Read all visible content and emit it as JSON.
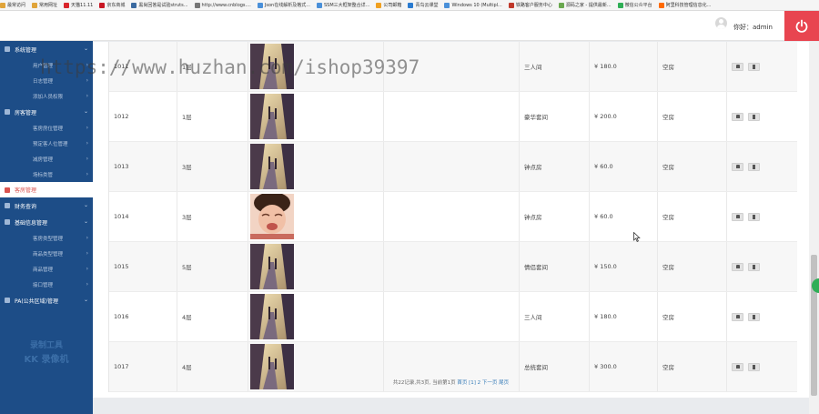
{
  "bookmarks": [
    {
      "label": "最常访问",
      "color": "#e0a43a"
    },
    {
      "label": "常用网址",
      "color": "#e0a43a"
    },
    {
      "label": "天猫11.11",
      "color": "#d9252b"
    },
    {
      "label": "京东商城",
      "color": "#c81623"
    },
    {
      "label": "黑尚回答是试验struts...",
      "color": "#3b6aa0"
    },
    {
      "label": "http://www.cnblogs....",
      "color": "#777777"
    },
    {
      "label": "Json在线解析及格式...",
      "color": "#4a90d9"
    },
    {
      "label": "SSM三大框架整合详...",
      "color": "#4a90d9"
    },
    {
      "label": "公司邮箱",
      "color": "#f0a020"
    },
    {
      "label": "青鸟云课堂",
      "color": "#2a7bd0"
    },
    {
      "label": "Windows 10 (Multipl...",
      "color": "#4a90d9"
    },
    {
      "label": "铁路客户服务中心",
      "color": "#c0392b"
    },
    {
      "label": "源码之家 - 提供最新...",
      "color": "#6aa84f"
    },
    {
      "label": "微信公众平台",
      "color": "#2fae56"
    },
    {
      "label": "阿里科技管理信息化...",
      "color": "#ff6a00"
    }
  ],
  "header": {
    "greeting": "你好：admin",
    "accent": "#e84550"
  },
  "sidebar": {
    "items": [
      {
        "kind": "section",
        "label": "系统管理"
      },
      {
        "kind": "sub",
        "label": "用户管理"
      },
      {
        "kind": "sub",
        "label": "日志管理"
      },
      {
        "kind": "sub",
        "label": "添加人员权限"
      },
      {
        "kind": "section",
        "label": "房客管理"
      },
      {
        "kind": "sub",
        "label": "客房房位管理"
      },
      {
        "kind": "sub",
        "label": "预定客人位管理"
      },
      {
        "kind": "sub",
        "label": "减房管理"
      },
      {
        "kind": "sub",
        "label": "场标类管"
      },
      {
        "kind": "active",
        "label": "客房管理"
      },
      {
        "kind": "section",
        "label": "财务查询"
      },
      {
        "kind": "section",
        "label": "基础信息管理"
      },
      {
        "kind": "sub",
        "label": "客房类型管理"
      },
      {
        "kind": "sub",
        "label": "商品类型管理"
      },
      {
        "kind": "sub",
        "label": "商品管理"
      },
      {
        "kind": "sub",
        "label": "接口管理"
      },
      {
        "kind": "section",
        "label": "PA(公共区域)管理"
      }
    ],
    "watermark_line1": "录制工具",
    "watermark_line2": "KK 录像机"
  },
  "table": {
    "rows": [
      {
        "id": "1011",
        "floor": "1层",
        "img": "street",
        "type": "三人间",
        "price": "¥ 180.0",
        "status": "空房"
      },
      {
        "id": "1012",
        "floor": "1层",
        "img": "street",
        "type": "豪华套间",
        "price": "¥ 200.0",
        "status": "空房"
      },
      {
        "id": "1013",
        "floor": "3层",
        "img": "street",
        "type": "钟点房",
        "price": "¥ 60.0",
        "status": "空房"
      },
      {
        "id": "1014",
        "floor": "3层",
        "img": "child",
        "type": "钟点房",
        "price": "¥ 60.0",
        "status": "空房"
      },
      {
        "id": "1015",
        "floor": "5层",
        "img": "street",
        "type": "情侣套间",
        "price": "¥ 150.0",
        "status": "空房"
      },
      {
        "id": "1016",
        "floor": "4层",
        "img": "street",
        "type": "三人间",
        "price": "¥ 180.0",
        "status": "空房"
      },
      {
        "id": "1017",
        "floor": "4层",
        "img": "street",
        "type": "总统套间",
        "price": "¥ 300.0",
        "status": "空房"
      }
    ],
    "edit_icon": "edit-icon",
    "delete_icon": "trash-icon"
  },
  "pager": {
    "summary": "共22记录,共3页, 当前第1页",
    "first": "首页",
    "pages": "[1] 2",
    "next": "下一页",
    "last": "尾页"
  },
  "overlay": {
    "url_watermark": "https://www.huzhan.com/ishop39397"
  }
}
